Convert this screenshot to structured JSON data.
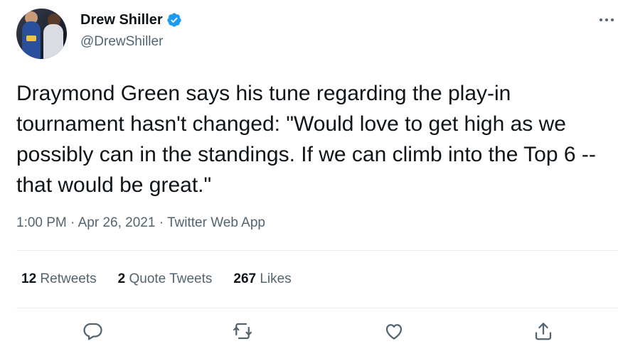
{
  "author": {
    "display_name": "Drew Shiller",
    "handle": "@DrewShiller",
    "verified": true
  },
  "tweet": {
    "text": "Draymond Green says his tune regarding the play-in tournament hasn't changed: \"Would love to get high as we possibly can in the standings. If we can climb into the Top 6 -- that would be great.\"",
    "time": "1:00 PM",
    "separator": " · ",
    "date": "Apr 26, 2021",
    "source": "Twitter Web App"
  },
  "stats": {
    "retweets_count": "12",
    "retweets_label": " Retweets",
    "quotes_count": "2",
    "quotes_label": " Quote Tweets",
    "likes_count": "267",
    "likes_label": " Likes"
  },
  "icons": {
    "more": "more-horizontal-icon",
    "reply": "reply-icon",
    "retweet": "retweet-icon",
    "like": "heart-icon",
    "share": "share-icon",
    "verified": "verified-badge-icon"
  },
  "colors": {
    "text": "#0f1419",
    "secondary": "#536471",
    "verified": "#1d9bf0",
    "divider": "#e6ecf0"
  }
}
